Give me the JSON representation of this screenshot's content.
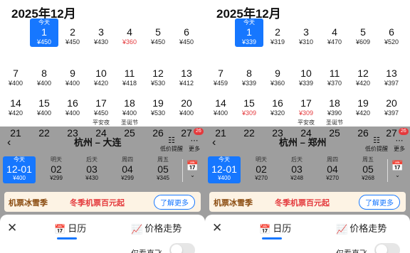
{
  "left": {
    "month_title": "2025年12月",
    "selected_top_label": "今天",
    "weeks": [
      [
        {
          "d": "1",
          "p": "¥450",
          "sel": true
        },
        {
          "d": "2",
          "p": "¥450"
        },
        {
          "d": "3",
          "p": "¥430"
        },
        {
          "d": "4",
          "p": "¥360",
          "red": true
        },
        {
          "d": "5",
          "p": "¥450"
        },
        {
          "d": "6",
          "p": "¥450"
        }
      ],
      [
        {
          "d": "7",
          "p": "¥400"
        },
        {
          "d": "8",
          "p": "¥400"
        },
        {
          "d": "9",
          "p": "¥400"
        },
        {
          "d": "10",
          "p": "¥420"
        },
        {
          "d": "11",
          "p": "¥418"
        },
        {
          "d": "12",
          "p": "¥530"
        },
        {
          "d": "13",
          "p": "¥412"
        }
      ],
      [
        {
          "d": "14",
          "p": "¥420"
        },
        {
          "d": "15",
          "p": "¥400"
        },
        {
          "d": "16",
          "p": "¥400"
        },
        {
          "d": "17",
          "p": "¥450"
        },
        {
          "d": "18",
          "p": "¥400"
        },
        {
          "d": "19",
          "p": "¥530"
        },
        {
          "d": "20",
          "p": "¥400"
        }
      ],
      [
        {
          "d": "21"
        },
        {
          "d": "22"
        },
        {
          "d": "23"
        },
        {
          "d": "24",
          "f": "平安夜"
        },
        {
          "d": "25",
          "f": "圣诞节"
        },
        {
          "d": "26"
        },
        {
          "d": "27"
        }
      ]
    ],
    "route": "杭州 – 大连",
    "actions": {
      "price_alert": "低价提醒",
      "more": "更多",
      "badge": "26"
    },
    "strip": [
      {
        "w": "今天",
        "n": "12-01",
        "p": "¥400",
        "sel": true
      },
      {
        "w": "明天",
        "n": "02",
        "p": "¥299"
      },
      {
        "w": "后天",
        "n": "03",
        "p": "¥430"
      },
      {
        "w": "周四",
        "n": "04",
        "p": "¥299"
      },
      {
        "w": "周五",
        "n": "05",
        "p": "¥345"
      }
    ],
    "promo": {
      "label": "机票冰雪季",
      "text": "冬季机票百元起",
      "btn": "了解更多"
    },
    "sheet": {
      "tab1": "日历",
      "tab2": "价格走势",
      "direct": "仅看直飞"
    }
  },
  "right": {
    "month_title": "2025年12月",
    "selected_top_label": "今天",
    "weeks": [
      [
        {
          "d": "1",
          "p": "¥339",
          "sel": true
        },
        {
          "d": "2",
          "p": "¥319"
        },
        {
          "d": "3",
          "p": "¥310"
        },
        {
          "d": "4",
          "p": "¥470"
        },
        {
          "d": "5",
          "p": "¥609"
        },
        {
          "d": "6",
          "p": "¥520"
        }
      ],
      [
        {
          "d": "7",
          "p": "¥459"
        },
        {
          "d": "8",
          "p": "¥339"
        },
        {
          "d": "9",
          "p": "¥360"
        },
        {
          "d": "10",
          "p": "¥339"
        },
        {
          "d": "11",
          "p": "¥370"
        },
        {
          "d": "12",
          "p": "¥420"
        },
        {
          "d": "13",
          "p": "¥397"
        }
      ],
      [
        {
          "d": "14",
          "p": "¥400"
        },
        {
          "d": "15",
          "p": "¥309",
          "red": true
        },
        {
          "d": "16",
          "p": "¥320"
        },
        {
          "d": "17",
          "p": "¥309",
          "red": true
        },
        {
          "d": "18",
          "p": "¥390"
        },
        {
          "d": "19",
          "p": "¥420"
        },
        {
          "d": "20",
          "p": "¥397"
        }
      ],
      [
        {
          "d": "21"
        },
        {
          "d": "22"
        },
        {
          "d": "23",
          "f": ""
        },
        {
          "d": "24",
          "f": "平安夜"
        },
        {
          "d": "25",
          "f": "圣诞节"
        },
        {
          "d": "26"
        },
        {
          "d": "27"
        }
      ]
    ],
    "route": "杭州 – 郑州",
    "actions": {
      "price_alert": "低价提醒",
      "more": "更多",
      "badge": "26"
    },
    "strip": [
      {
        "w": "今天",
        "n": "12-01",
        "p": "¥400",
        "sel": true
      },
      {
        "w": "明天",
        "n": "02",
        "p": "¥270"
      },
      {
        "w": "后天",
        "n": "03",
        "p": "¥248"
      },
      {
        "w": "周四",
        "n": "04",
        "p": "¥270"
      },
      {
        "w": "周五",
        "n": "05",
        "p": "¥268"
      }
    ],
    "promo": {
      "label": "机票冰雪季",
      "text": "冬季机票百元起",
      "btn": "了解更多"
    },
    "sheet": {
      "tab1": "日历",
      "tab2": "价格走势",
      "direct": "仅看直飞"
    }
  }
}
